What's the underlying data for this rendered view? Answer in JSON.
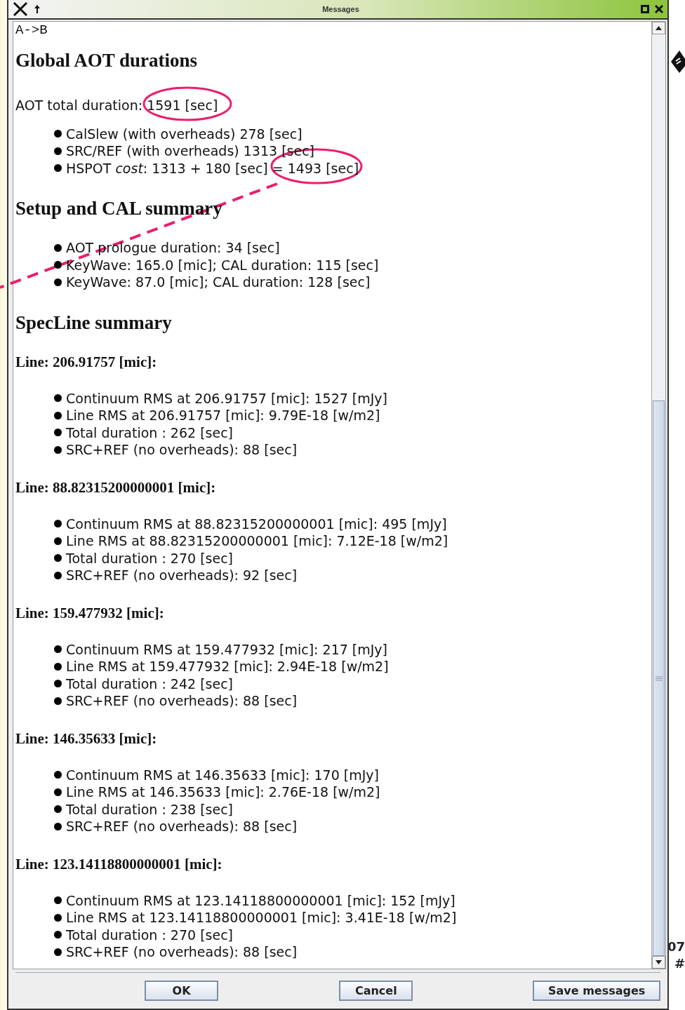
{
  "window": {
    "title": "Messages"
  },
  "message": {
    "header": "A->B",
    "sections": [
      {
        "kind": "list",
        "heading": "Global AOT durations",
        "intro": "AOT total duration: 1591 [sec]",
        "items": [
          "CalSlew (with overheads) 278 [sec]",
          "SRC/REF (with overheads) 1313 [sec]",
          "HSPOT *cost*: 1313 + 180 [sec] = 1493 [sec]"
        ]
      },
      {
        "kind": "list",
        "heading": "Setup and CAL summary",
        "items": [
          "AOT prologue duration: 34 [sec]",
          "KeyWave: 165.0 [mic]; CAL duration: 115 [sec]",
          "KeyWave: 87.0 [mic]; CAL duration: 128 [sec]"
        ]
      },
      {
        "kind": "lines",
        "heading": "SpecLine summary",
        "lines": [
          {
            "title": "Line: 206.91757 [mic]:",
            "items": [
              "Continuum RMS at 206.91757 [mic]: 1527 [mJy]",
              "Line RMS at 206.91757 [mic]: 9.79E-18 [w/m2]",
              "Total duration : 262 [sec]",
              "SRC+REF (no overheads): 88 [sec]"
            ]
          },
          {
            "title": "Line: 88.82315200000001 [mic]:",
            "items": [
              "Continuum RMS at 88.82315200000001 [mic]: 495 [mJy]",
              "Line RMS at 88.82315200000001 [mic]: 7.12E-18 [w/m2]",
              "Total duration : 270 [sec]",
              "SRC+REF (no overheads): 92 [sec]"
            ]
          },
          {
            "title": "Line: 159.477932 [mic]:",
            "items": [
              "Continuum RMS at 159.477932 [mic]: 217 [mJy]",
              "Line RMS at 159.477932 [mic]: 2.94E-18 [w/m2]",
              "Total duration : 242 [sec]",
              "SRC+REF (no overheads): 88 [sec]"
            ]
          },
          {
            "title": "Line: 146.35633 [mic]:",
            "items": [
              "Continuum RMS at 146.35633 [mic]: 170 [mJy]",
              "Line RMS at 146.35633 [mic]: 2.76E-18 [w/m2]",
              "Total duration : 238 [sec]",
              "SRC+REF (no overheads): 88 [sec]"
            ]
          },
          {
            "title": "Line: 123.14118800000001 [mic]:",
            "items": [
              "Continuum RMS at 123.14118800000001 [mic]: 152 [mJy]",
              "Line RMS at 123.14118800000001 [mic]: 3.41E-18 [w/m2]",
              "Total duration : 270 [sec]",
              "SRC+REF (no overheads): 88 [sec]"
            ]
          }
        ]
      }
    ]
  },
  "buttons": [
    "OK",
    "Cancel",
    "Save messages"
  ],
  "background_texts": [
    "07",
    "#"
  ]
}
